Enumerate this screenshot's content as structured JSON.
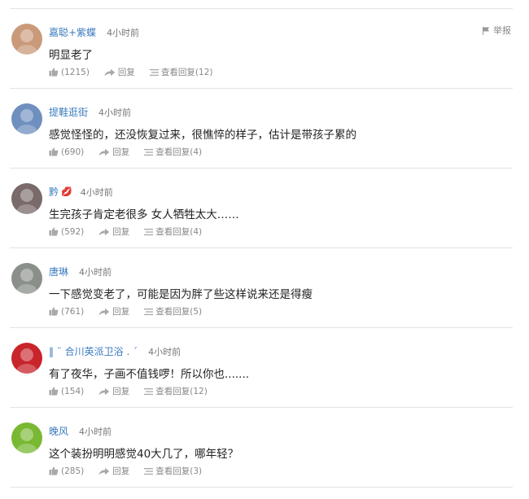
{
  "report": {
    "label": "举报"
  },
  "comments": [
    {
      "username": "嘉聪+紫蝶",
      "badge": "",
      "time": "4小时前",
      "text": "明显老了",
      "likes": "(1215)",
      "reply_label": "回复",
      "view_replies_label": "查看回复(12)",
      "avatar_color": "#c99a7a"
    },
    {
      "username": "提鞋逛街",
      "badge": "",
      "time": "4小时前",
      "text": "感觉怪怪的，还没恢复过来，很憔悴的样子，估计是带孩子累的",
      "likes": "(690)",
      "reply_label": "回复",
      "view_replies_label": "查看回复(4)",
      "avatar_color": "#6f8fbf"
    },
    {
      "username": "黔",
      "badge": "💋",
      "time": "4小时前",
      "text": "生完孩子肯定老很多  女人牺牲太大……",
      "likes": "(592)",
      "reply_label": "回复",
      "view_replies_label": "查看回复(4)",
      "avatar_color": "#7a6a6a"
    },
    {
      "username": "唐琳",
      "badge": "",
      "time": "4小时前",
      "text": "一下感觉变老了，可能是因为胖了些这样说来还是得瘦",
      "likes": "(761)",
      "reply_label": "回复",
      "view_replies_label": "查看回复(5)",
      "avatar_color": "#8a8f8a"
    },
    {
      "username": "‖ ¨ 合川英派卫浴 .  ˊ",
      "badge": "",
      "time": "4小时前",
      "text": "有了夜华，子画不值钱啰！所以你也.......",
      "likes": "(154)",
      "reply_label": "回复",
      "view_replies_label": "查看回复(12)",
      "avatar_color": "#c8242b"
    },
    {
      "username": "晚风",
      "badge": "",
      "time": "4小时前",
      "text": "这个装扮明明感觉40大几了，哪年轻？",
      "likes": "(285)",
      "reply_label": "回复",
      "view_replies_label": "查看回复(3)",
      "avatar_color": "#79b832"
    }
  ]
}
